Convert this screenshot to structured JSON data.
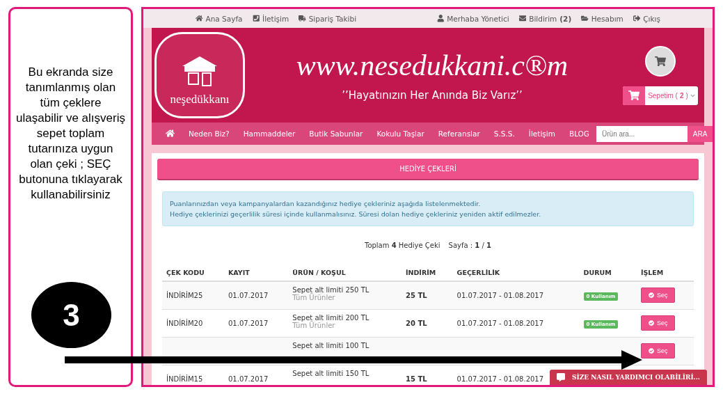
{
  "note": {
    "text": "Bu ekranda size tanımlanmış olan tüm çeklere ulaşabilir ve alışveriş sepet toplam tutarınıza  uygun olan çeki ; SEÇ butonuna tıklayarak kullanabilirsiniz"
  },
  "step": {
    "number": "3"
  },
  "top_bar": {
    "left": [
      {
        "kind": "home",
        "label": "Ana Sayfa"
      },
      {
        "kind": "phone",
        "label": "İletişim"
      },
      {
        "kind": "truck",
        "label": "Sipariş Takibi"
      }
    ],
    "right": [
      {
        "kind": "user",
        "label": "Merhaba Yönetici"
      },
      {
        "kind": "mail",
        "label": "Bildirim",
        "count": "(2)"
      },
      {
        "kind": "folder",
        "label": "Hesabım"
      },
      {
        "kind": "logout",
        "label": "Çıkış"
      }
    ]
  },
  "banner": {
    "logo_text": "neşedükkanı",
    "site": "www.nesedukkani.c®m",
    "slogan": "’’Hayatınızın Her Anında Biz Varız’’",
    "cart": {
      "label": "Sepetim (",
      "count": "2",
      "close": ")"
    }
  },
  "nav": {
    "items": [
      "Neden Biz?",
      "Hammaddeler",
      "Butik Sabunlar",
      "Kokulu Taşlar",
      "Referanslar",
      "S.S.S.",
      "İletişim",
      "BLOG"
    ],
    "search": {
      "placeholder": "Ürün ara...",
      "button": "ARA"
    }
  },
  "panel_title": "HEDİYE ÇEKLERİ",
  "alert": [
    "Puanlarınızdan veya kampanyalardan kazandığınız hediye çekleriniz aşağıda listelenmektedir.",
    "Hediye çeklerinizi geçerlilik süresi içinde kullanmalısınız. Süresi dolan hediye çekleriniz yeniden aktif edilmezler."
  ],
  "pager": {
    "text": "Toplam **4** Hediye Çeki",
    "page": "Sayfa : **1** / **1**"
  },
  "table": {
    "columns": [
      "ÇEK KODU",
      "KAYIT",
      "ÜRÜN / KOŞUL",
      "İNDİRİM",
      "GEÇERLİLİK",
      "DURUM",
      "İŞLEM"
    ],
    "rows": [
      {
        "code": "İNDİRİM25",
        "date": "01.07.2017",
        "condition": "Sepet alt limiti 250 TL",
        "scope": "Tüm Ürünler",
        "discount": "25 TL",
        "validity": "01.07.2017 - 01.08.2017",
        "status": "0 Kullanım",
        "action": "Seç"
      },
      {
        "code": "İNDİRİM20",
        "date": "01.07.2017",
        "condition": "Sepet alt limiti 200 TL",
        "scope": "Tüm Ürünler",
        "discount": "20 TL",
        "validity": "01.07.2017 - 01.08.2017",
        "status": "0 Kullanım",
        "action": "Seç"
      },
      {
        "condition": "Sepet alt limiti 100 TL",
        "action": "Seç"
      },
      {
        "code": "İNDİRİM15",
        "date": "01.07.2017",
        "condition": "Sepet alt limiti 150 TL",
        "discount": "15 TL",
        "validity": "01.07.2017 - 01.08.2017"
      }
    ]
  },
  "chat": {
    "label": "SİZE NASIL YARDIMCI OLABİLİRİ..."
  }
}
